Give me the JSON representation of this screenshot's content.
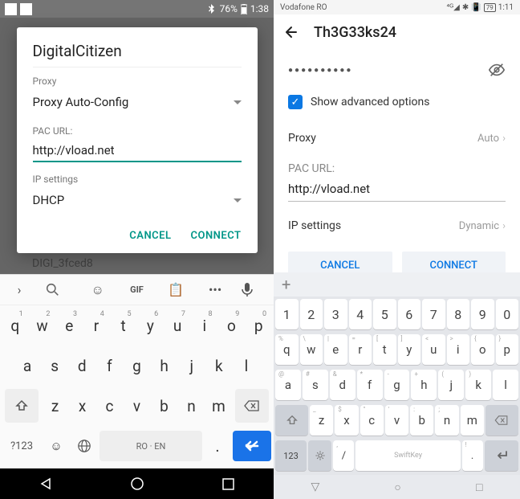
{
  "left": {
    "status": {
      "battery": "76%",
      "time": "1:38"
    },
    "dialog": {
      "title": "DigitalCitizen",
      "proxy_label": "Proxy",
      "proxy_value": "Proxy Auto-Config",
      "pac_label": "PAC URL:",
      "pac_value": "http://vload.net",
      "ip_label": "IP settings",
      "ip_value": "DHCP",
      "cancel": "CANCEL",
      "connect": "CONNECT"
    },
    "bg_item": "DIGI_3fced8",
    "keyboard": {
      "gif": "GIF",
      "row1": [
        "q",
        "w",
        "e",
        "r",
        "t",
        "y",
        "u",
        "i",
        "o",
        "p"
      ],
      "row1_sup": [
        "1",
        "2",
        "3",
        "4",
        "5",
        "6",
        "7",
        "8",
        "9",
        "0"
      ],
      "row2": [
        "a",
        "s",
        "d",
        "f",
        "g",
        "h",
        "j",
        "k",
        "l"
      ],
      "row3": [
        "z",
        "x",
        "c",
        "v",
        "b",
        "n",
        "m"
      ],
      "sym": "?123",
      "space": "RO · EN",
      "dot": "."
    }
  },
  "right": {
    "status": {
      "carrier": "Vodafone RO",
      "time": "1:11",
      "battery": "79"
    },
    "title": "Th3G33ks24",
    "password_dots": "●●●●●●●●●●",
    "show_adv": "Show advanced options",
    "proxy_k": "Proxy",
    "proxy_v": "Auto",
    "pac_label": "PAC URL:",
    "pac_value": "http://vload.net",
    "ip_k": "IP settings",
    "ip_v": "Dynamic",
    "cancel": "CANCEL",
    "connect": "CONNECT",
    "keyboard": {
      "nums": [
        "1",
        "2",
        "3",
        "4",
        "5",
        "6",
        "7",
        "8",
        "9",
        "0"
      ],
      "row1": [
        "q",
        "w",
        "e",
        "r",
        "t",
        "y",
        "u",
        "i",
        "o",
        "p"
      ],
      "row1_sup": [
        "%",
        "\\",
        "|",
        "=",
        "[",
        "]",
        "<",
        ">",
        "{",
        "}"
      ],
      "row2": [
        "a",
        "s",
        "d",
        "f",
        "g",
        "h",
        "j",
        "k",
        "l"
      ],
      "row2_sup": [
        "@",
        "#",
        "&",
        "*",
        "-",
        "+",
        "(",
        ")",
        ""
      ],
      "row3": [
        "z",
        "x",
        "c",
        "v",
        "b",
        "n",
        "m"
      ],
      "row3_sup": [
        "_",
        "$",
        "\"",
        "'",
        ":",
        ";",
        "",
        ""
      ],
      "sym": "123",
      "space": "SwiftKey",
      "excl": "!",
      "slash": "/",
      "comma": ",",
      "dot": "."
    }
  }
}
